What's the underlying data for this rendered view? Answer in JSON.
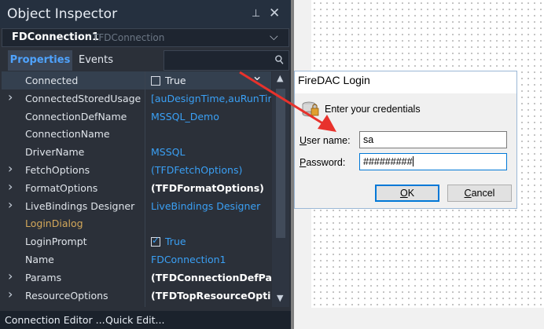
{
  "inspector": {
    "title": "Object Inspector",
    "pin_glyph": "⊥",
    "close_glyph": "✕",
    "component_name": "FDConnection1",
    "component_type": "TFDConnection",
    "tabs": {
      "properties": "Properties",
      "events": "Events"
    },
    "properties": [
      {
        "name": "Connected",
        "value": "True",
        "expandable": false,
        "checkbox": "unchecked",
        "bold": false,
        "selected": true,
        "muted": false
      },
      {
        "name": "ConnectedStoredUsage",
        "value": "[auDesignTime,auRunTim",
        "expandable": true,
        "checkbox": "",
        "bold": false,
        "selected": false,
        "muted": false
      },
      {
        "name": "ConnectionDefName",
        "value": "MSSQL_Demo",
        "expandable": false,
        "checkbox": "",
        "bold": false,
        "selected": false,
        "muted": false
      },
      {
        "name": "ConnectionName",
        "value": "",
        "expandable": false,
        "checkbox": "",
        "bold": false,
        "selected": false,
        "muted": false
      },
      {
        "name": "DriverName",
        "value": "MSSQL",
        "expandable": false,
        "checkbox": "",
        "bold": false,
        "selected": false,
        "muted": false
      },
      {
        "name": "FetchOptions",
        "value": "(TFDFetchOptions)",
        "expandable": true,
        "checkbox": "",
        "bold": false,
        "selected": false,
        "muted": false
      },
      {
        "name": "FormatOptions",
        "value": "(TFDFormatOptions)",
        "expandable": true,
        "checkbox": "",
        "bold": true,
        "selected": false,
        "muted": false
      },
      {
        "name": "LiveBindings Designer",
        "value": "LiveBindings Designer",
        "expandable": true,
        "checkbox": "",
        "bold": false,
        "selected": false,
        "muted": false
      },
      {
        "name": "LoginDialog",
        "value": "",
        "expandable": false,
        "checkbox": "",
        "bold": false,
        "selected": false,
        "muted": true
      },
      {
        "name": "LoginPrompt",
        "value": "True",
        "expandable": false,
        "checkbox": "checked",
        "bold": false,
        "selected": false,
        "muted": false
      },
      {
        "name": "Name",
        "value": "FDConnection1",
        "expandable": false,
        "checkbox": "",
        "bold": false,
        "selected": false,
        "muted": false
      },
      {
        "name": "Params",
        "value": "(TFDConnectionDefPara",
        "expandable": true,
        "checkbox": "",
        "bold": true,
        "selected": false,
        "muted": false
      },
      {
        "name": "ResourceOptions",
        "value": "(TFDTopResourceOption",
        "expandable": true,
        "checkbox": "",
        "bold": true,
        "selected": false,
        "muted": false
      }
    ],
    "footer": {
      "connection_editor": "Connection Editor ...",
      "quick_edit": "Quick Edit..."
    }
  },
  "dialog": {
    "title": "FireDAC Login",
    "prompt": "Enter your credentials",
    "user_label_prefix": "U",
    "user_label_rest": "ser name:",
    "user_value": "sa",
    "password_label_prefix": "P",
    "password_label_rest": "assword:",
    "password_value": "#########",
    "ok_label_u": "O",
    "ok_label_rest": "K",
    "cancel_label_u": "C",
    "cancel_label_rest": "ancel"
  },
  "colors": {
    "inspector_bg": "#2b3039",
    "value_blue": "#3aa0f5",
    "annotation_arrow": "#e8322c",
    "focus_border": "#0078d7"
  }
}
